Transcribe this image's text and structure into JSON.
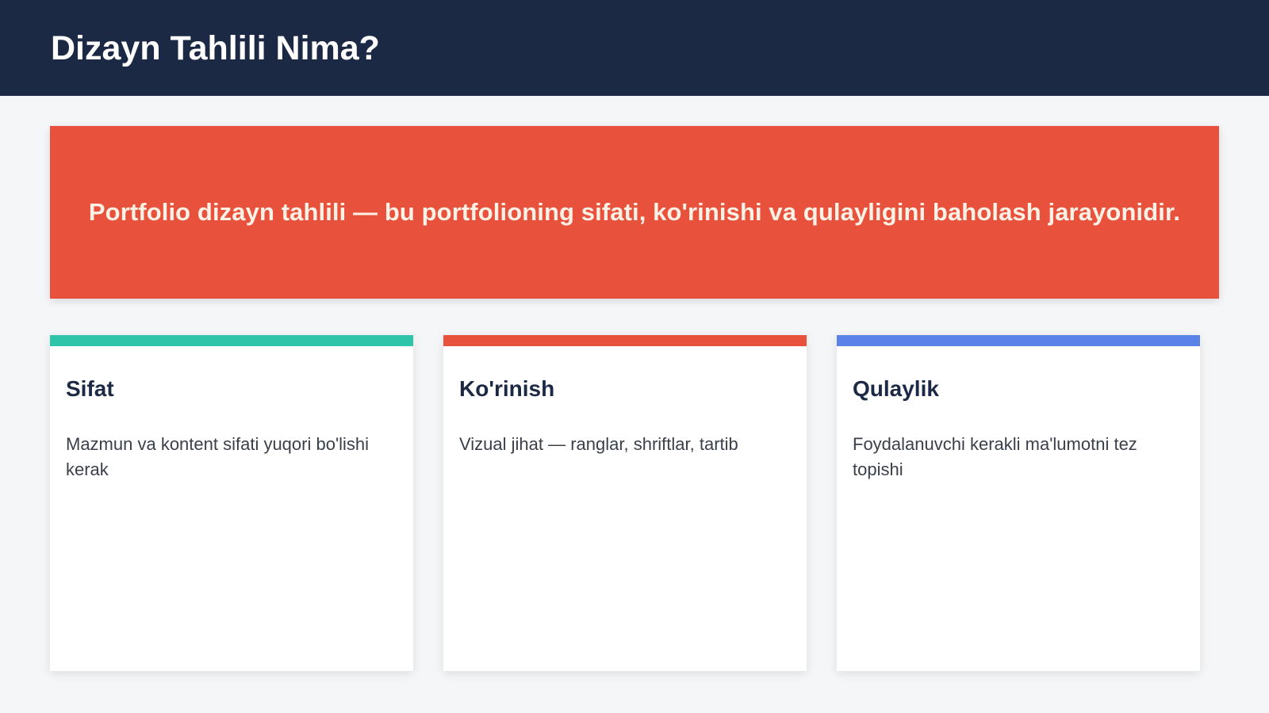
{
  "header": {
    "title": "Dizayn Tahlili Nima?"
  },
  "banner": {
    "text": "Portfolio dizayn tahlili — bu portfolioning sifati, ko'rinishi va qulayligini baholash jarayonidir."
  },
  "cards": [
    {
      "title": "Sifat",
      "body": "Mazmun va kontent sifati yuqori bo'lishi kerak",
      "accent": "#2ec4a9"
    },
    {
      "title": "Ko'rinish",
      "body": "Vizual jihat — ranglar, shriftlar, tartib",
      "accent": "#e8523d"
    },
    {
      "title": "Qulaylik",
      "body": "Foydalanuvchi kerakli ma'lumotni tez topishi",
      "accent": "#5b82e6"
    }
  ],
  "colors": {
    "header_bg": "#1c2945",
    "banner_bg": "#e8523d",
    "page_bg": "#f5f6f8"
  }
}
